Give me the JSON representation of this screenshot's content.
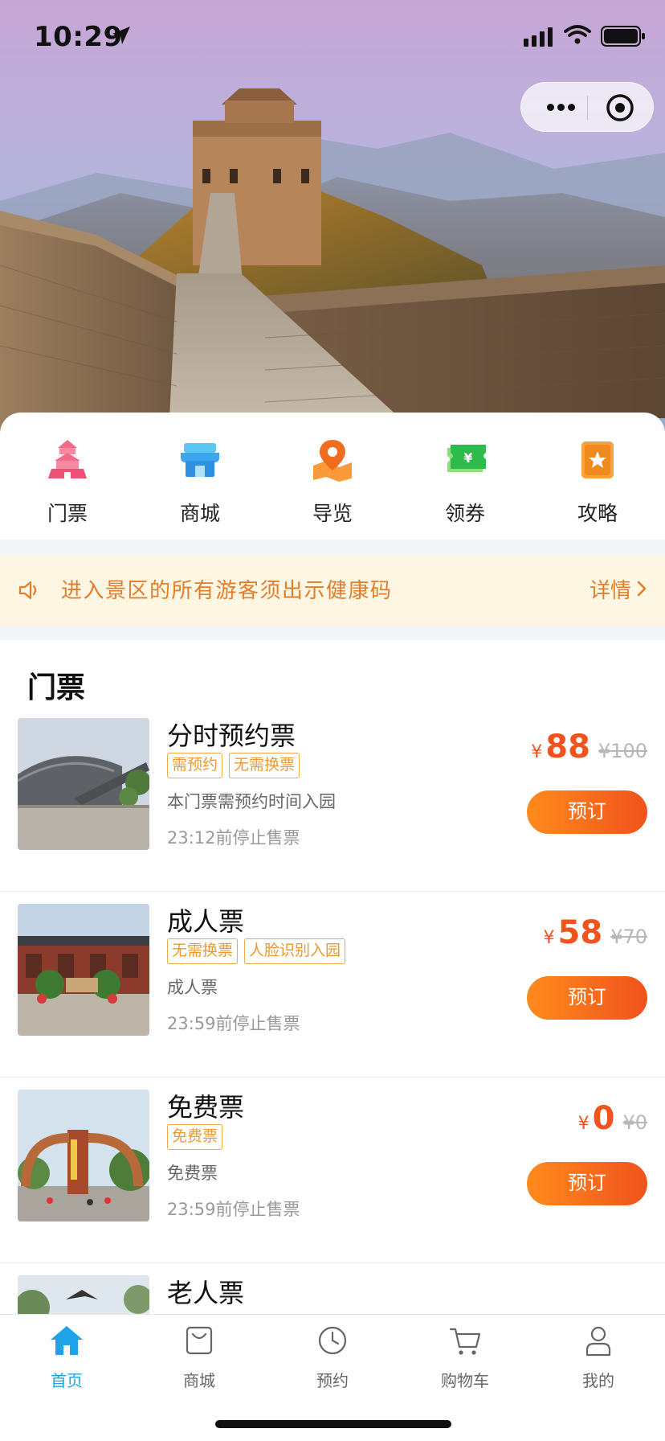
{
  "status_bar": {
    "time": "10:29"
  },
  "nav": [
    {
      "label": "门票",
      "icon": "pagoda-icon"
    },
    {
      "label": "商城",
      "icon": "shop-icon"
    },
    {
      "label": "导览",
      "icon": "map-pin-icon"
    },
    {
      "label": "领券",
      "icon": "coupon-icon"
    },
    {
      "label": "攻略",
      "icon": "guide-book-icon"
    }
  ],
  "notice": {
    "text": "进入景区的所有游客须出示健康码",
    "more": "详情"
  },
  "tickets": {
    "title": "门票",
    "items": [
      {
        "name": "分时预约票",
        "tags": [
          "需预约",
          "无需换票"
        ],
        "desc": "本门票需预约时间入园",
        "stop": "23:12前停止售票",
        "currency": "¥",
        "price": "88",
        "old_price": "¥100",
        "button": "预订"
      },
      {
        "name": "成人票",
        "tags": [
          "无需换票",
          "人脸识别入园"
        ],
        "desc": "成人票",
        "stop": "23:59前停止售票",
        "currency": "¥",
        "price": "58",
        "old_price": "¥70",
        "button": "预订"
      },
      {
        "name": "免费票",
        "tags": [
          "免费票"
        ],
        "desc": "免费票",
        "stop": "23:59前停止售票",
        "currency": "¥",
        "price": "0",
        "old_price": "¥0",
        "button": "预订"
      },
      {
        "name": "老人票"
      }
    ]
  },
  "tabbar": [
    {
      "label": "首页",
      "icon": "home-icon",
      "active": true
    },
    {
      "label": "商城",
      "icon": "bag-icon"
    },
    {
      "label": "预约",
      "icon": "clock-icon"
    },
    {
      "label": "购物车",
      "icon": "cart-icon"
    },
    {
      "label": "我的",
      "icon": "user-icon"
    }
  ],
  "colors": {
    "accent": "#f0531d",
    "tab_active": "#1fa3e8",
    "notice": "#e27d2b"
  }
}
